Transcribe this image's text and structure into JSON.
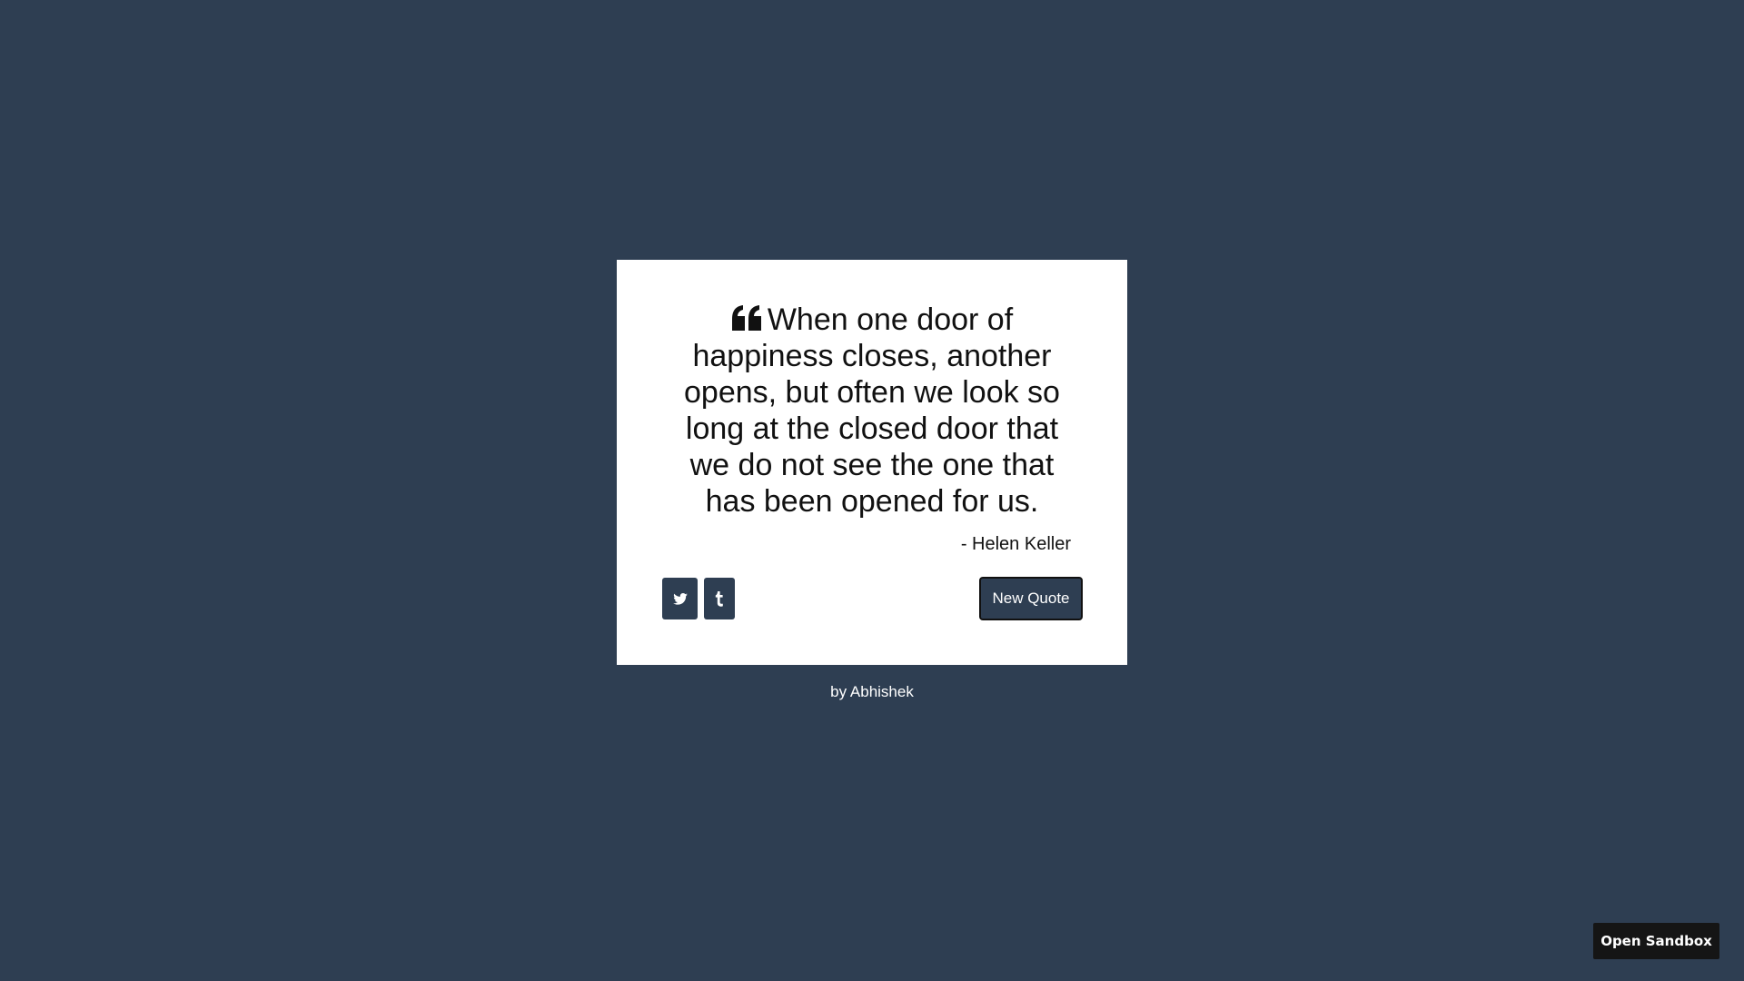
{
  "quote": {
    "text": "When one door of happiness closes, another opens, but often we look so long at the closed door that we do not see the one that has been opened for us.",
    "author": "- Helen Keller",
    "icon": "quote-left-icon"
  },
  "share": {
    "twitter_icon": "twitter-icon",
    "tumblr_icon": "tumblr-icon"
  },
  "actions": {
    "new_quote_label": "New Quote"
  },
  "footer": {
    "credit": "by Abhishek"
  },
  "sandbox": {
    "label": "Open Sandbox"
  },
  "colors": {
    "background": "#2e3e52",
    "card": "#ffffff",
    "text": "#111111",
    "sandbox_button": "#151515"
  }
}
